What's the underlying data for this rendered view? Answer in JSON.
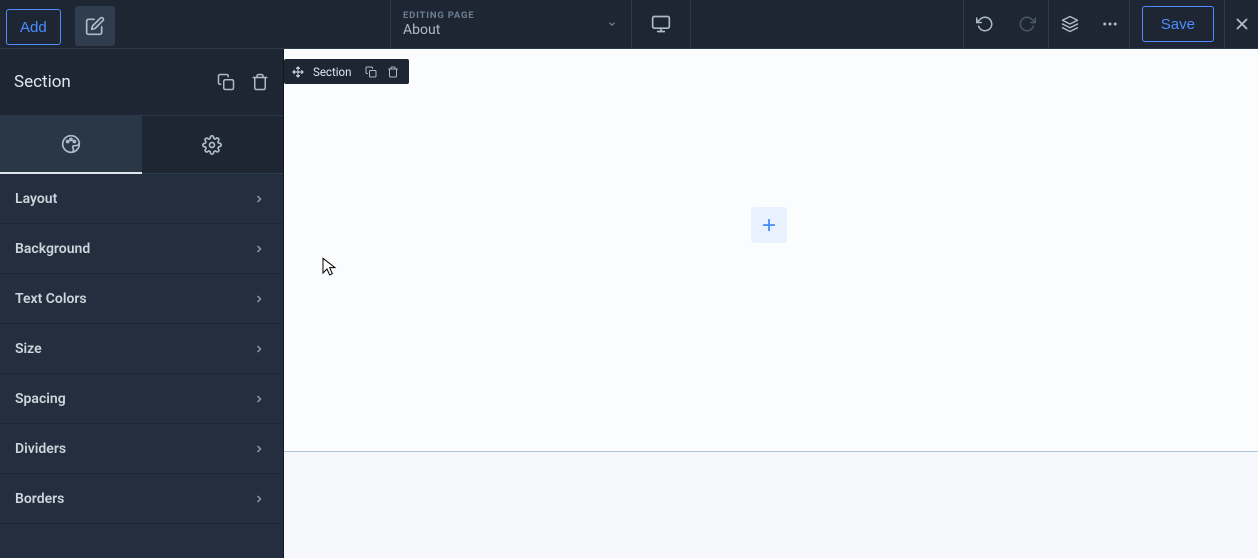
{
  "topbar": {
    "add_label": "Add",
    "save_label": "Save",
    "page_selector_label": "EDITING PAGE",
    "page_selector_value": "About"
  },
  "sidebar": {
    "title": "Section",
    "items": [
      {
        "label": "Layout"
      },
      {
        "label": "Background"
      },
      {
        "label": "Text Colors"
      },
      {
        "label": "Size"
      },
      {
        "label": "Spacing"
      },
      {
        "label": "Dividers"
      },
      {
        "label": "Borders"
      }
    ]
  },
  "canvas": {
    "section_label": "Section"
  },
  "colors": {
    "accent": "#4d8dff",
    "bg_dark": "#1d2632",
    "bg_panel": "#232f3e"
  }
}
